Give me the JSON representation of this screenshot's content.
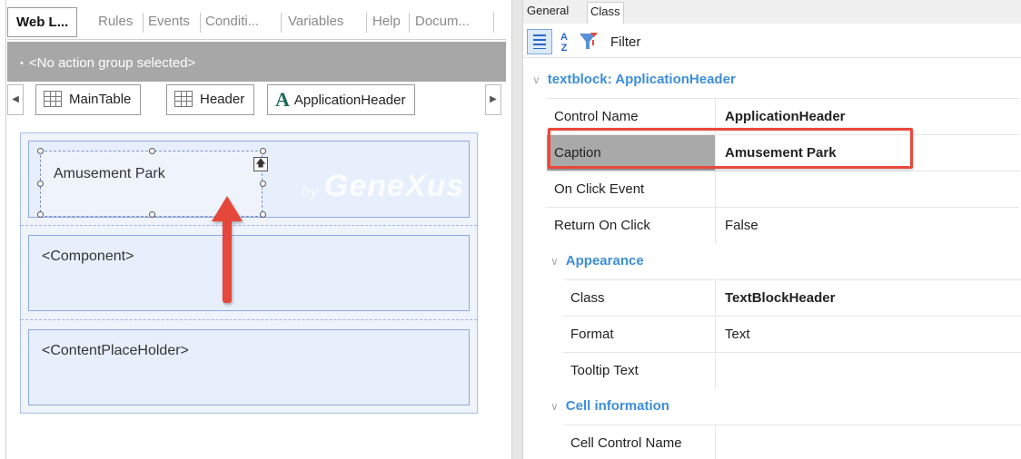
{
  "left": {
    "tabs": [
      "Web L...",
      "Rules",
      "Events",
      "Conditi...",
      "Variables",
      "Help",
      "Docum..."
    ],
    "action_group": "<No action group selected>",
    "breadcrumbs": [
      "MainTable",
      "Header",
      "ApplicationHeader"
    ],
    "canvas": {
      "header_text": "Amusement Park",
      "watermark_prefix": "by",
      "watermark": "GeneXus",
      "component": "<Component>",
      "content_placeholder": "<ContentPlaceHolder>"
    }
  },
  "right": {
    "tabs": [
      "General",
      "Class"
    ],
    "toolbar": {
      "sort_label": "A Z",
      "filter_label": "Filter"
    },
    "section_main": "textblock: ApplicationHeader",
    "rows_main": [
      {
        "name": "Control Name",
        "value": "ApplicationHeader"
      },
      {
        "name": "Caption",
        "value": "Amusement Park"
      },
      {
        "name": "On Click Event",
        "value": ""
      },
      {
        "name": "Return On Click",
        "value": "False"
      }
    ],
    "section_appearance": "Appearance",
    "rows_appearance": [
      {
        "name": "Class",
        "value": "TextBlockHeader"
      },
      {
        "name": "Format",
        "value": "Text"
      },
      {
        "name": "Tooltip Text",
        "value": ""
      }
    ],
    "section_cell": "Cell information",
    "rows_cell": [
      {
        "name": "Cell Control Name",
        "value": ""
      }
    ]
  },
  "colors": {
    "accent_blue": "#3d8ed8",
    "highlight_red": "#e8483b",
    "arrow_red": "#e5473b"
  }
}
